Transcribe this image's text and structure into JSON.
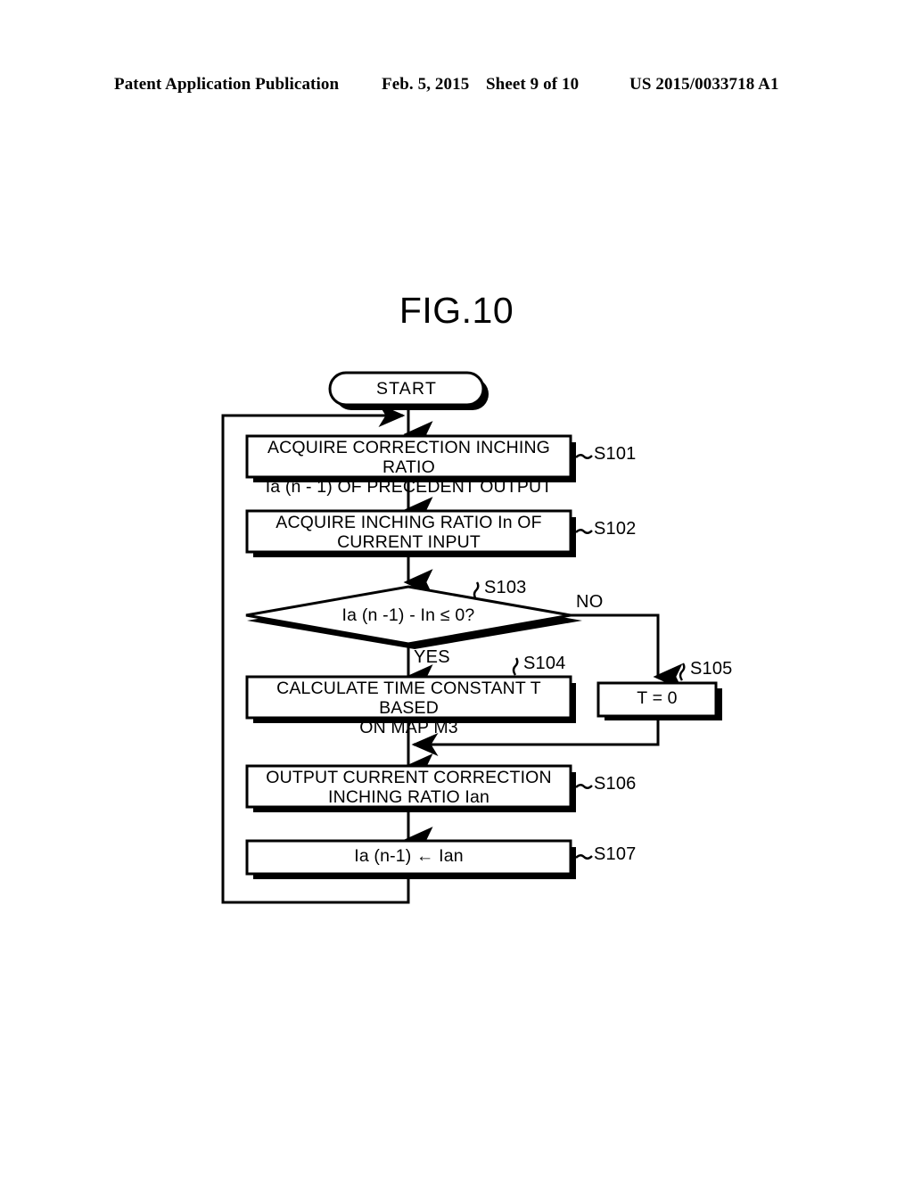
{
  "header": {
    "publication": "Patent Application Publication",
    "date": "Feb. 5, 2015",
    "sheet": "Sheet 9 of 10",
    "number": "US 2015/0033718 A1"
  },
  "figure": {
    "title": "FIG.10",
    "type": "flowchart",
    "line_color": "#000000",
    "background": "#ffffff"
  },
  "flowchart": {
    "nodes": {
      "start": {
        "shape": "stadium",
        "label": "START"
      },
      "s101": {
        "shape": "process",
        "step": "S101",
        "label": "ACQUIRE CORRECTION INCHING RATIO\nIa (n - 1) OF PRECEDENT OUTPUT"
      },
      "s102": {
        "shape": "process",
        "step": "S102",
        "label": "ACQUIRE INCHING RATIO In OF\nCURRENT INPUT"
      },
      "s103": {
        "shape": "decision",
        "step": "S103",
        "label": "Ia (n -1) - In ≤ 0?"
      },
      "s104": {
        "shape": "process",
        "step": "S104",
        "label": "CALCULATE TIME CONSTANT T BASED\nON MAP M3"
      },
      "s105": {
        "shape": "process",
        "step": "S105",
        "label": "T = 0"
      },
      "s106": {
        "shape": "process",
        "step": "S106",
        "label": "OUTPUT CURRENT CORRECTION\nINCHING RATIO Ian"
      },
      "s107": {
        "shape": "process",
        "step": "S107",
        "label": "Ia (n-1) ← Ian"
      }
    },
    "branches": {
      "yes": "YES",
      "no": "NO"
    },
    "edges": [
      {
        "from": "start",
        "to": "s101",
        "label": ""
      },
      {
        "from": "s101",
        "to": "s102",
        "label": ""
      },
      {
        "from": "s102",
        "to": "s103",
        "label": ""
      },
      {
        "from": "s103",
        "to": "s104",
        "label": "YES"
      },
      {
        "from": "s103",
        "to": "s105",
        "label": "NO"
      },
      {
        "from": "s104",
        "to": "s106",
        "label": ""
      },
      {
        "from": "s105",
        "to": "s106",
        "label": ""
      },
      {
        "from": "s106",
        "to": "s107",
        "label": ""
      },
      {
        "from": "s107",
        "to": "s101",
        "label": "loop-back"
      }
    ]
  }
}
